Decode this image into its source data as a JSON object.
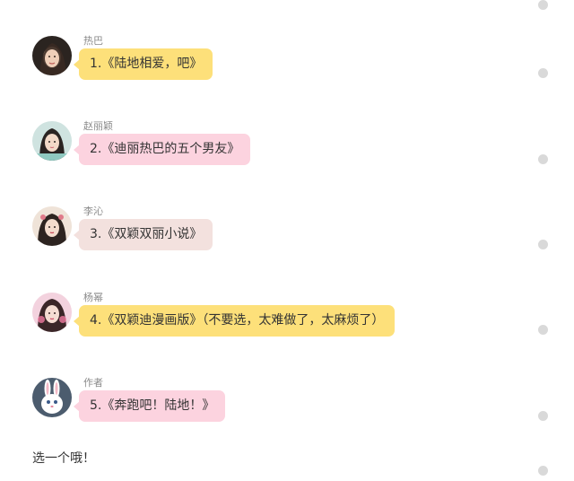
{
  "colors": {
    "yellow": "#fde07a",
    "pink": "#fcd3df",
    "beige": "#f3e1de",
    "dot": "#d9d9d9"
  },
  "messages": [
    {
      "sender": "热巴",
      "text": "1.《陆地相爱，吧》",
      "bubble_color": "#fde07a",
      "avatar_icon": "dilraba-avatar"
    },
    {
      "sender": "赵丽颖",
      "text": "2.《迪丽热巴的五个男友》",
      "bubble_color": "#fcd3df",
      "avatar_icon": "zhao-liying-avatar"
    },
    {
      "sender": "李沁",
      "text": "3.《双颖双丽小说》",
      "bubble_color": "#f3e1de",
      "avatar_icon": "li-qin-avatar"
    },
    {
      "sender": "杨幂",
      "text": "4.《双颖迪漫画版》（不要选，太难做了，太麻烦了）",
      "bubble_color": "#fde07a",
      "avatar_icon": "yang-mi-avatar"
    },
    {
      "sender": "作者",
      "text": "5.《奔跑吧！陆地！》",
      "bubble_color": "#fcd3df",
      "avatar_icon": "bunny-avatar"
    }
  ],
  "footer": {
    "text": "选一个哦！"
  }
}
